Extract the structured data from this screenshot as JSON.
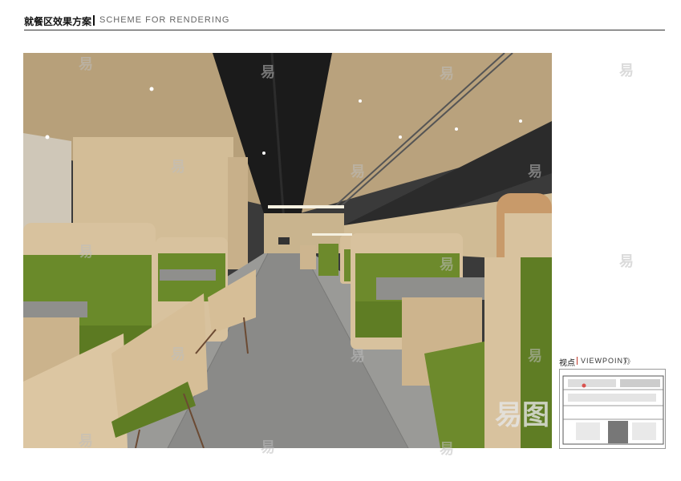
{
  "header": {
    "title_cn": "就餐区效果方案",
    "title_en": "SCHEME FOR RENDERING"
  },
  "viewpoint": {
    "label_cn": "视点",
    "label_en": "VIEWPOINT",
    "arrows": "》》"
  },
  "watermark": {
    "text": "易",
    "logo": "易图"
  },
  "colors": {
    "ceiling": "#b9a27c",
    "wood": "#d9c39f",
    "seat_green": "#6d8a2c",
    "floor": "#8c8c8a",
    "dark_ceiling": "#1f1f1f"
  }
}
